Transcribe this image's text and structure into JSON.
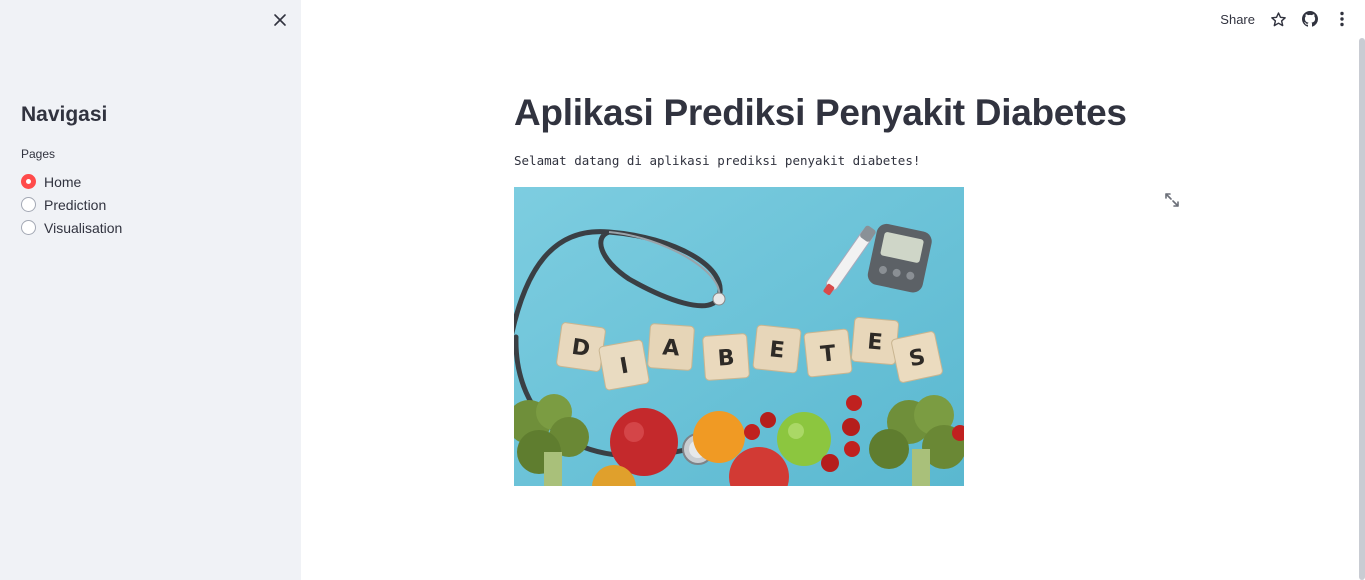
{
  "sidebar": {
    "title": "Navigasi",
    "radio_label": "Pages",
    "options": [
      {
        "label": "Home",
        "selected": true
      },
      {
        "label": "Prediction",
        "selected": false
      },
      {
        "label": "Visualisation",
        "selected": false
      }
    ]
  },
  "toolbar": {
    "share_label": "Share",
    "icons": [
      "star-icon",
      "github-icon",
      "more-vertical-icon"
    ]
  },
  "main": {
    "title": "Aplikasi Prediksi Penyakit Diabetes",
    "subtitle": "Selamat datang di aplikasi prediksi penyakit diabetes!",
    "hero_letters": [
      "D",
      "I",
      "A",
      "B",
      "E",
      "T",
      "E",
      "S"
    ]
  },
  "colors": {
    "accent": "#ff4b4b",
    "sidebar_bg": "#f0f2f6",
    "text": "#31333f",
    "image_bg": "#6ec3d8"
  }
}
